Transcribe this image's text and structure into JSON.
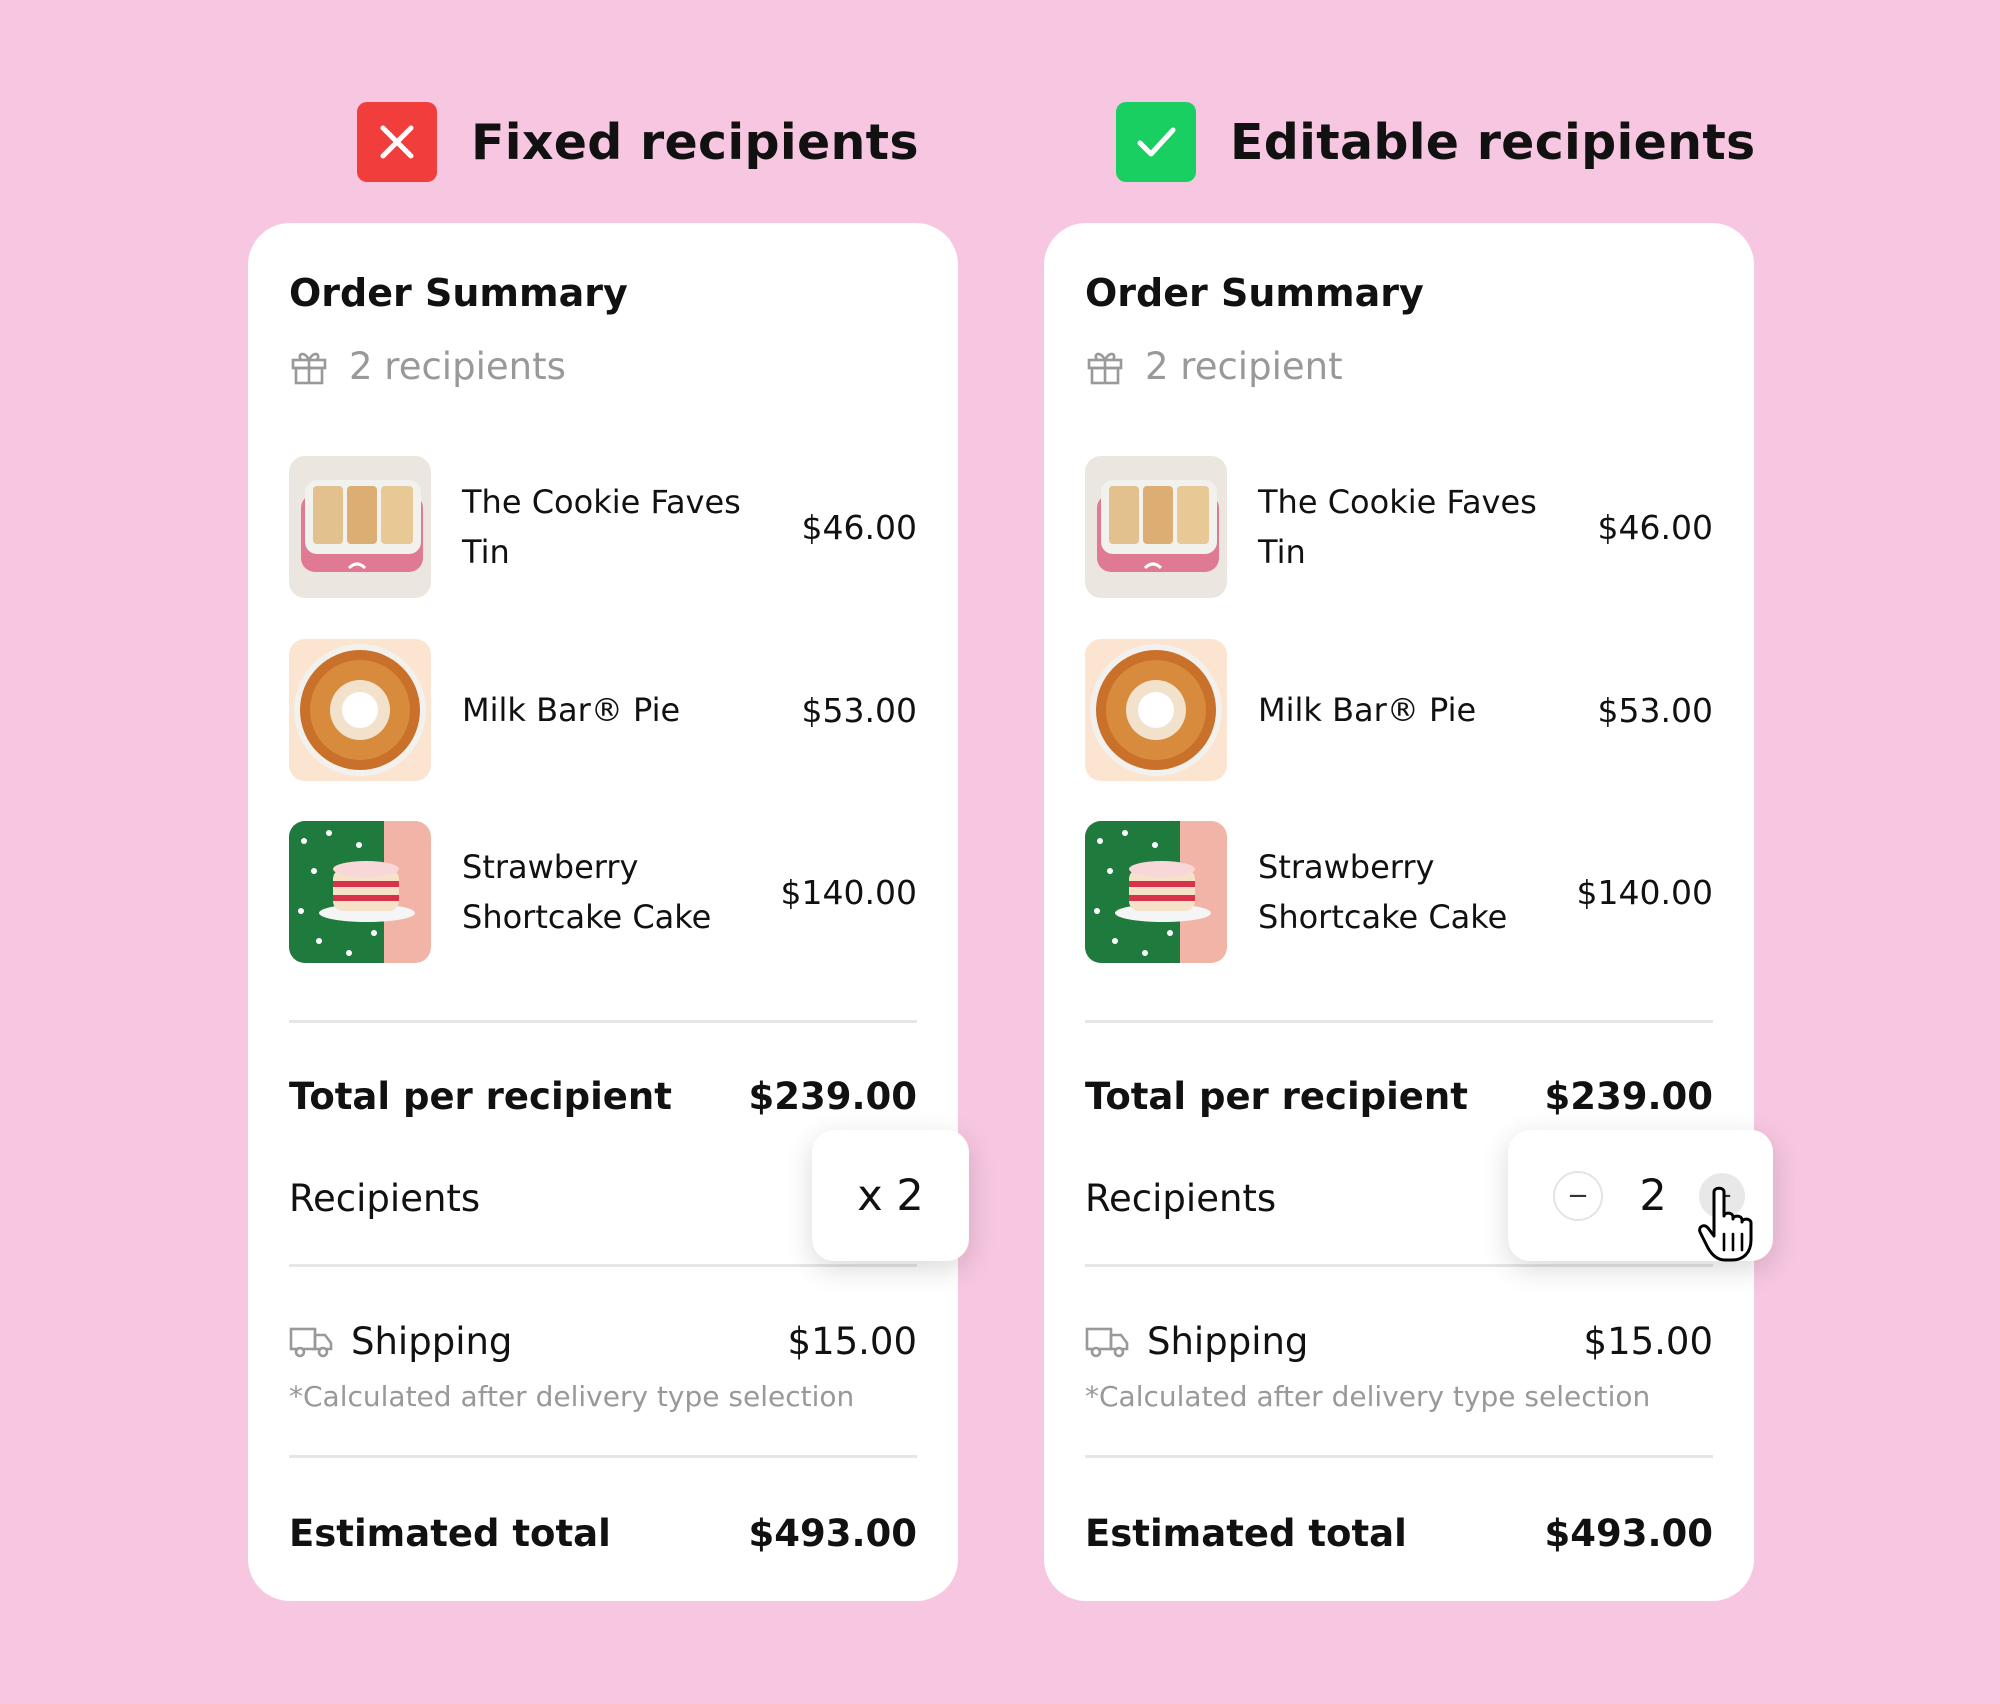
{
  "headings": {
    "fixed": {
      "label": "Fixed recipients",
      "icon": "x-icon",
      "color": "#f23d3d"
    },
    "editable": {
      "label": "Editable recipients",
      "icon": "check-icon",
      "color": "#19cf62"
    }
  },
  "cards": {
    "fixed": {
      "title": "Order Summary",
      "recipients_line": "2 recipients",
      "items": [
        {
          "name": "The Cookie Faves Tin",
          "price": "$46.00",
          "image": "cookie-tin-image"
        },
        {
          "name": "Milk Bar® Pie",
          "price": "$53.00",
          "image": "pie-image"
        },
        {
          "name": "Strawberry Shortcake Cake",
          "price": "$140.00",
          "image": "cake-image"
        }
      ],
      "total_per_recipient": {
        "label": "Total per recipient",
        "value": "$239.00"
      },
      "recipients": {
        "label": "Recipients",
        "value": "x 2"
      },
      "shipping": {
        "label": "Shipping",
        "value": "$15.00",
        "note": "*Calculated after delivery type selection"
      },
      "estimated_total": {
        "label": "Estimated total",
        "value": "$493.00"
      }
    },
    "editable": {
      "title": "Order Summary",
      "recipients_line": "2 recipient",
      "items": [
        {
          "name": "The Cookie Faves Tin",
          "price": "$46.00",
          "image": "cookie-tin-image"
        },
        {
          "name": "Milk Bar® Pie",
          "price": "$53.00",
          "image": "pie-image"
        },
        {
          "name": "Strawberry Shortcake Cake",
          "price": "$140.00",
          "image": "cake-image"
        }
      ],
      "total_per_recipient": {
        "label": "Total per recipient",
        "value": "$239.00"
      },
      "recipients": {
        "label": "Recipients",
        "value": "2",
        "decrement": "−",
        "increment": "+"
      },
      "shipping": {
        "label": "Shipping",
        "value": "$15.00",
        "note": "*Calculated after delivery type selection"
      },
      "estimated_total": {
        "label": "Estimated total",
        "value": "$493.00"
      }
    }
  },
  "colors": {
    "background": "#f7c6e0",
    "card": "#ffffff",
    "muted": "#999999"
  }
}
